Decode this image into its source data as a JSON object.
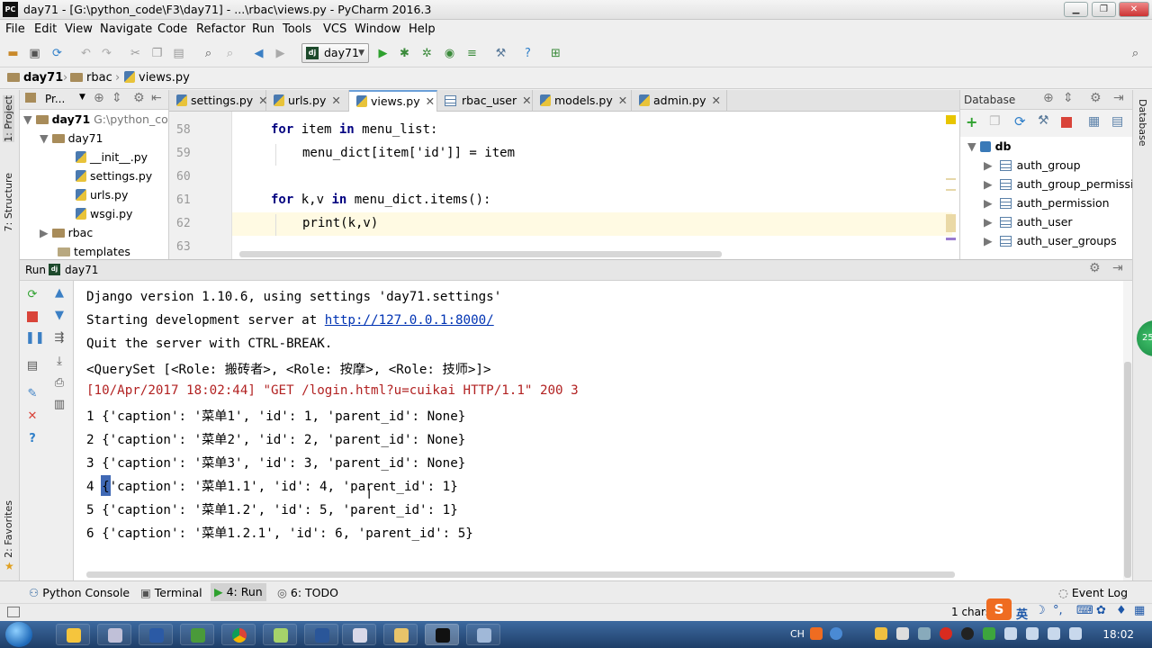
{
  "window": {
    "title": "day71 - [G:\\python_code\\F3\\day71] - ...\\rbac\\views.py - PyCharm 2016.3",
    "app_icon": "PC"
  },
  "menu": [
    "File",
    "Edit",
    "View",
    "Navigate",
    "Code",
    "Refactor",
    "Run",
    "Tools",
    "VCS",
    "Window",
    "Help"
  ],
  "toolbar": {
    "run_config": "day71"
  },
  "breadcrumb": [
    "day71",
    "rbac",
    "views.py"
  ],
  "left_strip": {
    "project": "1: Project",
    "structure": "7: Structure",
    "favorites": "2: Favorites"
  },
  "project_panel": {
    "header": "Pr...",
    "items": [
      {
        "label": "day71",
        "extra": "G:\\python_cod"
      },
      {
        "label": "day71"
      },
      {
        "label": "__init__.py"
      },
      {
        "label": "settings.py"
      },
      {
        "label": "urls.py"
      },
      {
        "label": "wsgi.py"
      },
      {
        "label": "rbac"
      },
      {
        "label": "templates"
      }
    ]
  },
  "tabs": [
    "settings.py",
    "urls.py",
    "views.py",
    "rbac_user",
    "models.py",
    "admin.py"
  ],
  "editor": {
    "lines": [
      {
        "n": "58",
        "kw": "for",
        "a": " item ",
        "kw2": "in",
        "b": " menu_list:"
      },
      {
        "n": "59",
        "text": "menu_dict[item['id']] = item"
      },
      {
        "n": "60"
      },
      {
        "n": "61",
        "kw": "for",
        "a": " k,v ",
        "kw2": "in",
        "b": " menu_dict.items():"
      },
      {
        "n": "62",
        "text": "print(k,v)"
      },
      {
        "n": "63"
      }
    ]
  },
  "database_panel": {
    "header": "Database",
    "root": "db",
    "tables": [
      "auth_group",
      "auth_group_permissio",
      "auth_permission",
      "auth_user",
      "auth_user_groups"
    ]
  },
  "right_strip": {
    "label": "Database",
    "badge": "25"
  },
  "run_panel": {
    "label": "Run",
    "config": "day71"
  },
  "console": [
    {
      "text": "Django version 1.10.6, using settings 'day71.settings'"
    },
    {
      "pre": "Starting development server at ",
      "link": "http://127.0.0.1:8000/"
    },
    {
      "text": "Quit the server with CTRL-BREAK."
    },
    {
      "text": "<QuerySet [<Role: 搬砖者>, <Role: 按摩>, <Role: 技师>]>"
    },
    {
      "text": "[10/Apr/2017 18:02:44] \"GET /login.html?u=cuikai HTTP/1.1\" 200 3",
      "err": true
    },
    {
      "text": "1 {'caption': '菜单1', 'id': 1, 'parent_id': None}"
    },
    {
      "text": "2 {'caption': '菜单2', 'id': 2, 'parent_id': None}"
    },
    {
      "text": "3 {'caption': '菜单3', 'id': 3, 'parent_id': None}"
    },
    {
      "text": "4 {'caption': '菜单1.1', 'id': 4, 'parent_id': 1}"
    },
    {
      "text": "5 {'caption': '菜单1.2', 'id': 5, 'parent_id': 1}"
    },
    {
      "text": "6 {'caption': '菜单1.2.1', 'id': 6, 'parent_id': 5}"
    }
  ],
  "tool_windows": [
    "Python Console",
    "Terminal",
    "4: Run",
    "6: TODO"
  ],
  "event_log": "Event Log",
  "status": {
    "chars": "1 chars",
    "ime": "英"
  },
  "taskbar": {
    "time": "18:02",
    "lang": "CH"
  }
}
